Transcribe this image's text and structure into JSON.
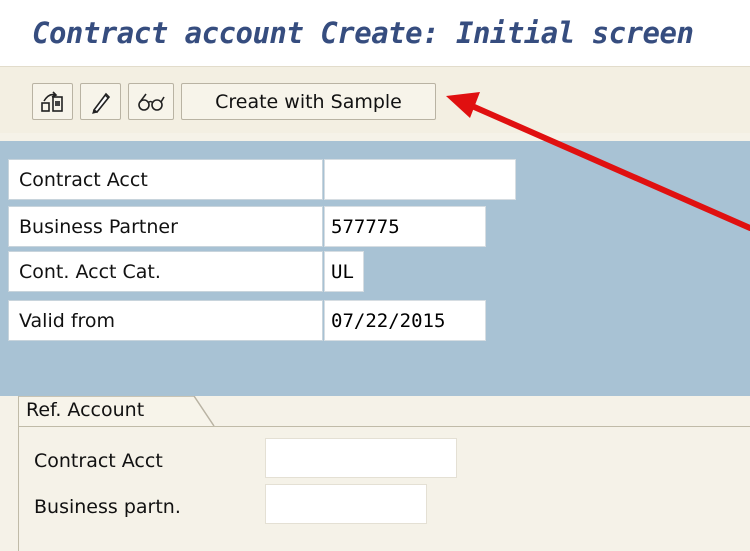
{
  "title": "Contract account Create: Initial screen",
  "toolbar": {
    "create_with_sample_label": "Create with Sample"
  },
  "header_fields": [
    {
      "label": "Contract Acct",
      "value": ""
    },
    {
      "label": "Business Partner",
      "value": "577775"
    },
    {
      "label": "Cont. Acct Cat.",
      "value": "UL"
    },
    {
      "label": "Valid from",
      "value": "07/22/2015"
    }
  ],
  "ref_account": {
    "tab_label": "Ref. Account",
    "fields": [
      {
        "label": "Contract Acct",
        "value": ""
      },
      {
        "label": "Business partn.",
        "value": ""
      }
    ]
  },
  "icons": [
    "create-icon",
    "change-pencil-icon",
    "display-glasses-icon",
    "red-arrow-annotation"
  ],
  "colors": {
    "title": "#364d7f",
    "panel_blue": "#a8c2d4",
    "background": "#f5f2e8",
    "arrow": "#e01010"
  }
}
